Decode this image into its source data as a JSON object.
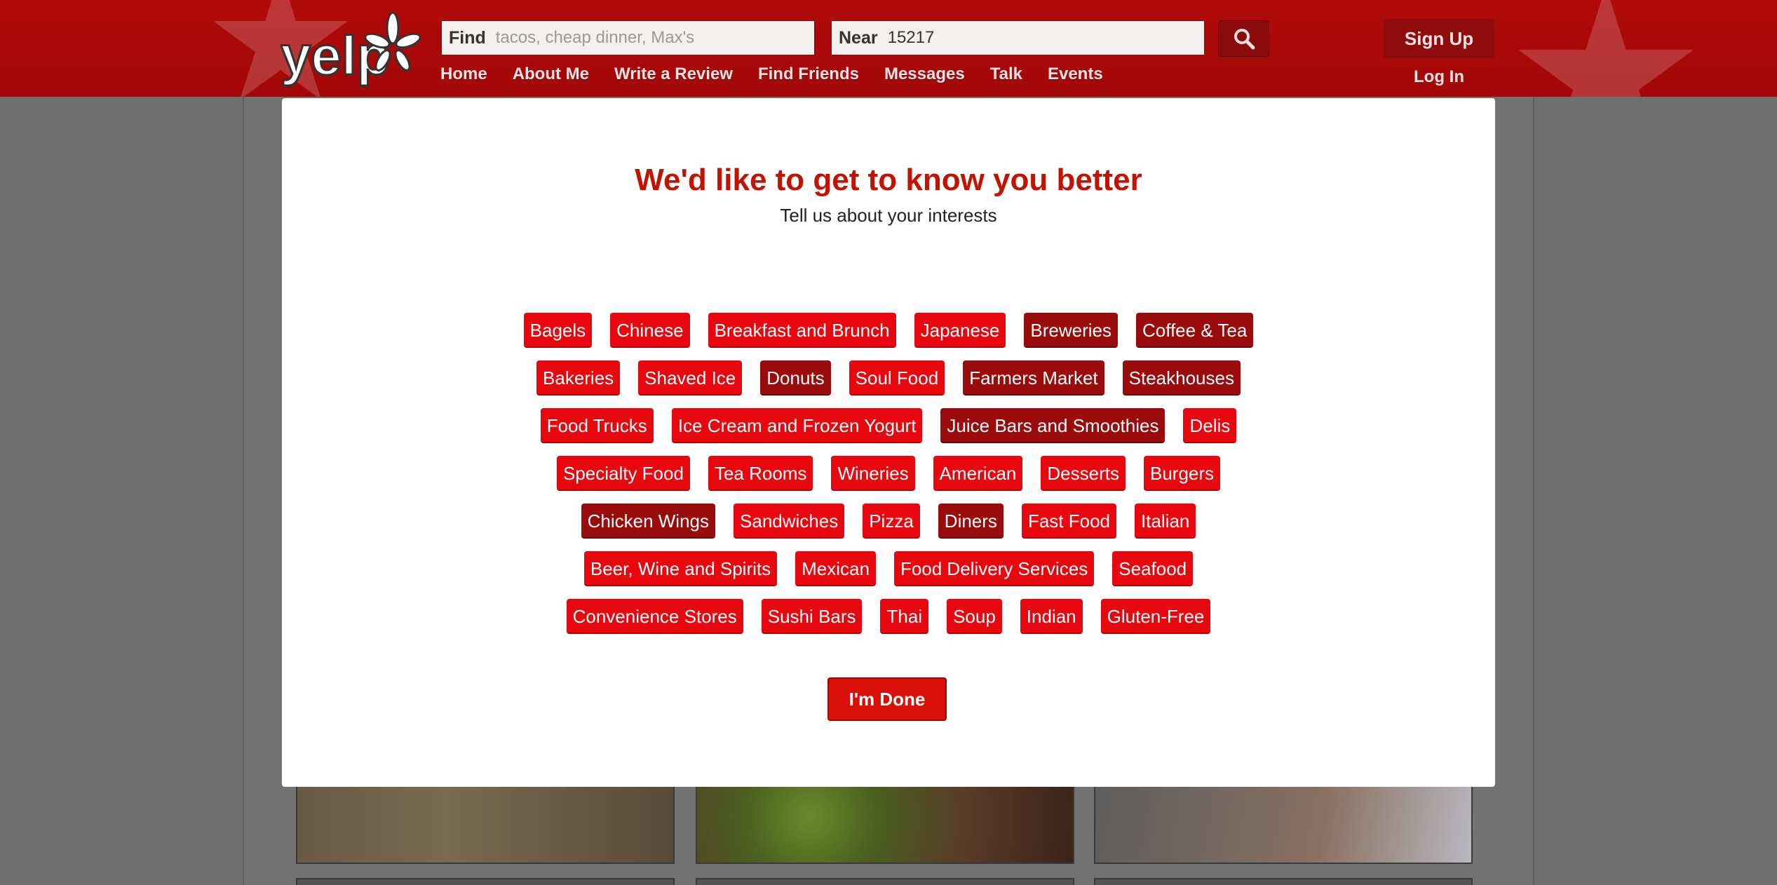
{
  "header": {
    "logo_text": "yelp",
    "find_label": "Find",
    "find_placeholder": "tacos, cheap dinner, Max's",
    "near_label": "Near",
    "near_value": "15217",
    "nav": [
      "Home",
      "About Me",
      "Write a Review",
      "Find Friends",
      "Messages",
      "Talk",
      "Events"
    ],
    "signup_label": "Sign Up",
    "login_label": "Log In"
  },
  "modal": {
    "title": "We'd like to get to know you better",
    "subtitle": "Tell us about your interests",
    "tags": [
      {
        "label": "Bagels",
        "selected": false
      },
      {
        "label": "Chinese",
        "selected": false
      },
      {
        "label": "Breakfast and Brunch",
        "selected": false
      },
      {
        "label": "Japanese",
        "selected": false
      },
      {
        "label": "Breweries",
        "selected": true
      },
      {
        "label": "Coffee & Tea",
        "selected": true
      },
      {
        "label": "Bakeries",
        "selected": false
      },
      {
        "label": "Shaved Ice",
        "selected": false
      },
      {
        "label": "Donuts",
        "selected": true
      },
      {
        "label": "Soul Food",
        "selected": false
      },
      {
        "label": "Farmers Market",
        "selected": true
      },
      {
        "label": "Steakhouses",
        "selected": true
      },
      {
        "label": "Food Trucks",
        "selected": false
      },
      {
        "label": "Ice Cream and Frozen Yogurt",
        "selected": false
      },
      {
        "label": "Juice Bars and Smoothies",
        "selected": true
      },
      {
        "label": "Delis",
        "selected": false
      },
      {
        "label": "Specialty Food",
        "selected": false
      },
      {
        "label": "Tea Rooms",
        "selected": false
      },
      {
        "label": "Wineries",
        "selected": false
      },
      {
        "label": "American",
        "selected": false
      },
      {
        "label": "Desserts",
        "selected": false
      },
      {
        "label": "Burgers",
        "selected": false
      },
      {
        "label": "Chicken Wings",
        "selected": true
      },
      {
        "label": "Sandwiches",
        "selected": false
      },
      {
        "label": "Pizza",
        "selected": false
      },
      {
        "label": "Diners",
        "selected": true
      },
      {
        "label": "Fast Food",
        "selected": false
      },
      {
        "label": "Italian",
        "selected": false
      },
      {
        "label": "Beer, Wine and Spirits",
        "selected": false
      },
      {
        "label": "Mexican",
        "selected": false
      },
      {
        "label": "Food Delivery Services",
        "selected": false
      },
      {
        "label": "Seafood",
        "selected": false
      },
      {
        "label": "Convenience Stores",
        "selected": false
      },
      {
        "label": "Sushi Bars",
        "selected": false
      },
      {
        "label": "Thai",
        "selected": false
      },
      {
        "label": "Soup",
        "selected": false
      },
      {
        "label": "Indian",
        "selected": false
      },
      {
        "label": "Gluten-Free",
        "selected": false
      }
    ],
    "done_label": "I'm Done"
  },
  "icons": {
    "search": "search-icon",
    "logo_burst": "yelp-burst-icon"
  },
  "colors": {
    "brand_red": "#c41200",
    "tag_red": "#e8070e",
    "tag_selected": "#9a0c0c",
    "header_bg": "#b00a0a"
  }
}
